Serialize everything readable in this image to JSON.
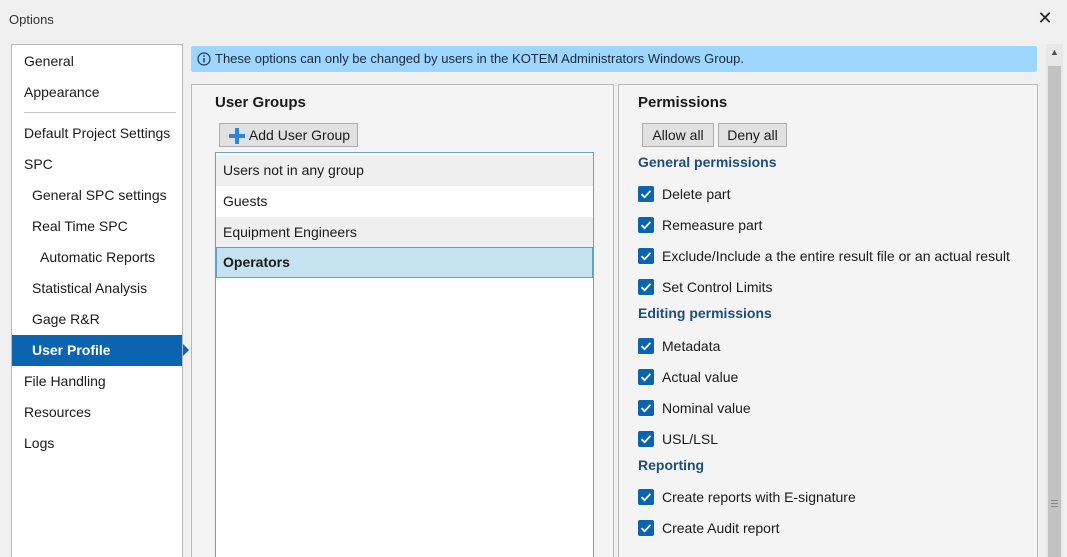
{
  "window": {
    "title": "Options"
  },
  "nav": {
    "items": [
      {
        "label": "General"
      },
      {
        "label": "Appearance"
      },
      {
        "label": "Default Project Settings"
      },
      {
        "label": "SPC"
      },
      {
        "label": "General SPC settings"
      },
      {
        "label": "Real Time SPC"
      },
      {
        "label": "Automatic Reports"
      },
      {
        "label": "Statistical Analysis"
      },
      {
        "label": "Gage R&R"
      },
      {
        "label": "User Profile"
      },
      {
        "label": "File Handling"
      },
      {
        "label": "Resources"
      },
      {
        "label": "Logs"
      }
    ],
    "selected": "User Profile"
  },
  "info": {
    "text": "These options can only be changed by users in the KOTEM Administrators Windows Group."
  },
  "groups": {
    "title": "User Groups",
    "add_label": "Add User Group",
    "rows": [
      {
        "label": "Users not in any group"
      },
      {
        "label": "Guests"
      },
      {
        "label": "Equipment Engineers"
      },
      {
        "label": "Operators"
      }
    ],
    "selected": "Operators"
  },
  "permissions": {
    "title": "Permissions",
    "allow_all": "Allow all",
    "deny_all": "Deny all",
    "sections": [
      {
        "title": "General permissions",
        "items": [
          {
            "label": "Delete part",
            "checked": true
          },
          {
            "label": "Remeasure part",
            "checked": true
          },
          {
            "label": "Exclude/Include a the entire result file or an actual result",
            "checked": true
          },
          {
            "label": "Set Control Limits",
            "checked": true
          }
        ]
      },
      {
        "title": "Editing permissions",
        "items": [
          {
            "label": "Metadata",
            "checked": true
          },
          {
            "label": "Actual value",
            "checked": true
          },
          {
            "label": "Nominal value",
            "checked": true
          },
          {
            "label": "USL/LSL",
            "checked": true
          }
        ]
      },
      {
        "title": "Reporting",
        "items": [
          {
            "label": "Create reports with E-signature",
            "checked": true
          },
          {
            "label": "Create Audit report",
            "checked": true
          }
        ]
      }
    ]
  },
  "colors": {
    "accent": "#0a64b0",
    "info_bg": "#9dd6ff",
    "section_title": "#1f4e78"
  }
}
